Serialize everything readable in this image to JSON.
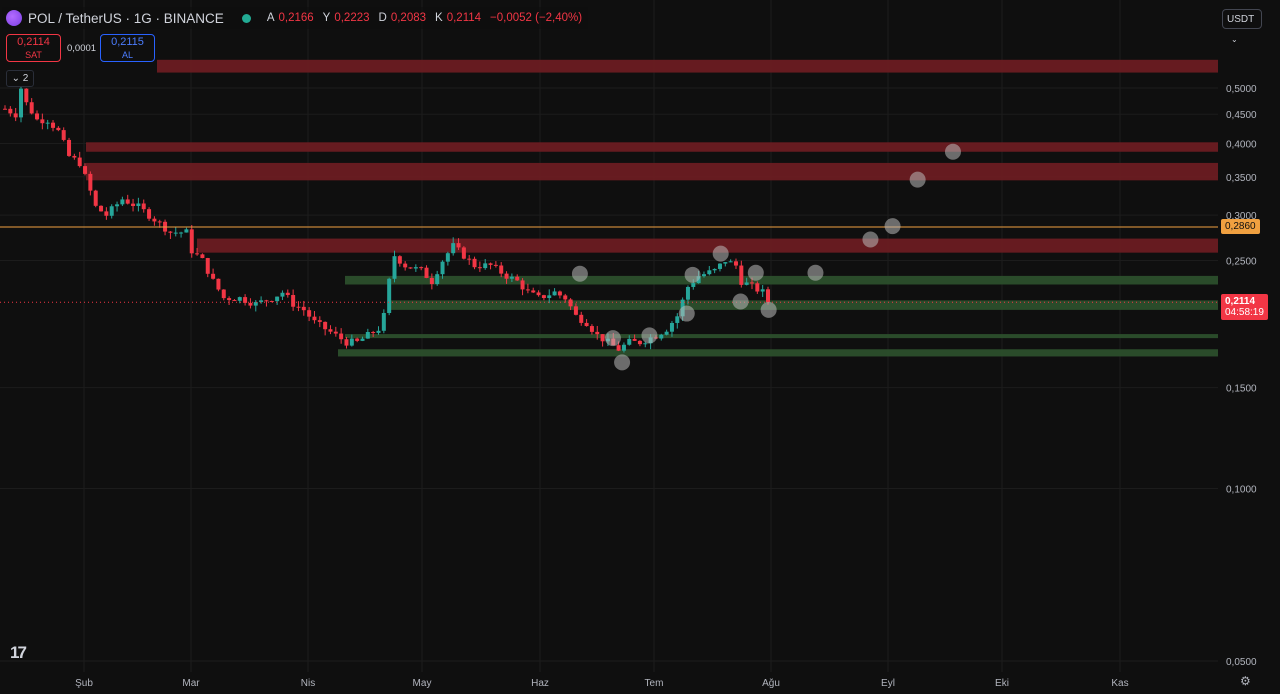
{
  "header": {
    "title": "POL / TetherUS · 1G · BINANCE",
    "ohlc": [
      {
        "label": "A",
        "value": "0,2166"
      },
      {
        "label": "Y",
        "value": "0,2223"
      },
      {
        "label": "D",
        "value": "0,2083"
      },
      {
        "label": "K",
        "value": "0,2114"
      }
    ],
    "change": "−0,0052 (−2,40%)"
  },
  "trade": {
    "sell_price": "0,2114",
    "sell_label": "SAT",
    "spread": "0,0001",
    "buy_price": "0,2115",
    "buy_label": "AL"
  },
  "indicator_toggle": "2",
  "currency_button": "USDT",
  "colors": {
    "background": "#0f0f0f",
    "up": "#26a69a",
    "down": "#f23645",
    "red_zone": "#6b1c22",
    "green_zone": "#2c4f2c",
    "orange_line": "#f0a040",
    "grid": "#1c1c1c"
  },
  "chart_data": {
    "type": "candlestick",
    "y_scale": "log",
    "ylim": [
      0.0478,
      0.55
    ],
    "ticks_y": [
      {
        "value": 0.5,
        "label": "0,5000"
      },
      {
        "value": 0.45,
        "label": "0,4500"
      },
      {
        "value": 0.4,
        "label": "0,4000"
      },
      {
        "value": 0.35,
        "label": "0,3500"
      },
      {
        "value": 0.3,
        "label": "0,3000"
      },
      {
        "value": 0.25,
        "label": "0,2500"
      },
      {
        "value": 0.15,
        "label": "0,1500"
      },
      {
        "value": 0.1,
        "label": "0,1000"
      },
      {
        "value": 0.05,
        "label": "0,0500"
      }
    ],
    "ticks_x": [
      {
        "label": "Şub",
        "month": 2
      },
      {
        "label": "Mar",
        "month": 3
      },
      {
        "label": "Nis",
        "month": 4
      },
      {
        "label": "May",
        "month": 5
      },
      {
        "label": "Haz",
        "month": 6
      },
      {
        "label": "Tem",
        "month": 7
      },
      {
        "label": "Ağu",
        "month": 8
      },
      {
        "label": "Eyl",
        "month": 9
      },
      {
        "label": "Eki",
        "month": 10
      },
      {
        "label": "Kas",
        "month": 11
      }
    ],
    "price_path": [
      [
        0,
        0.46
      ],
      [
        2,
        0.45
      ],
      [
        3,
        0.5
      ],
      [
        4,
        0.47
      ],
      [
        6,
        0.44
      ],
      [
        8,
        0.44
      ],
      [
        10,
        0.42
      ],
      [
        12,
        0.38
      ],
      [
        14,
        0.37
      ],
      [
        16,
        0.33
      ],
      [
        17,
        0.31
      ],
      [
        19,
        0.3
      ],
      [
        22,
        0.32
      ],
      [
        25,
        0.31
      ],
      [
        27,
        0.3
      ],
      [
        29,
        0.29
      ],
      [
        31,
        0.28
      ],
      [
        34,
        0.28
      ],
      [
        35,
        0.26
      ],
      [
        37,
        0.25
      ],
      [
        39,
        0.23
      ],
      [
        41,
        0.215
      ],
      [
        44,
        0.215
      ],
      [
        47,
        0.21
      ],
      [
        50,
        0.215
      ],
      [
        52,
        0.22
      ],
      [
        54,
        0.21
      ],
      [
        56,
        0.205
      ],
      [
        58,
        0.195
      ],
      [
        60,
        0.19
      ],
      [
        62,
        0.185
      ],
      [
        64,
        0.18
      ],
      [
        66,
        0.18
      ],
      [
        68,
        0.185
      ],
      [
        70,
        0.19
      ],
      [
        71,
        0.2
      ],
      [
        72,
        0.23
      ],
      [
        73,
        0.255
      ],
      [
        75,
        0.245
      ],
      [
        78,
        0.24
      ],
      [
        80,
        0.23
      ],
      [
        82,
        0.25
      ],
      [
        84,
        0.265
      ],
      [
        86,
        0.255
      ],
      [
        88,
        0.245
      ],
      [
        91,
        0.245
      ],
      [
        94,
        0.235
      ],
      [
        96,
        0.23
      ],
      [
        98,
        0.22
      ],
      [
        100,
        0.215
      ],
      [
        103,
        0.22
      ],
      [
        105,
        0.215
      ],
      [
        107,
        0.2
      ],
      [
        109,
        0.195
      ],
      [
        111,
        0.185
      ],
      [
        113,
        0.18
      ],
      [
        115,
        0.175
      ],
      [
        117,
        0.18
      ],
      [
        119,
        0.18
      ],
      [
        122,
        0.185
      ],
      [
        124,
        0.19
      ],
      [
        126,
        0.2
      ],
      [
        128,
        0.225
      ],
      [
        130,
        0.235
      ],
      [
        133,
        0.24
      ],
      [
        135,
        0.25
      ],
      [
        137,
        0.245
      ],
      [
        138,
        0.23
      ],
      [
        140,
        0.225
      ],
      [
        142,
        0.22
      ],
      [
        143,
        0.2114
      ]
    ],
    "candle_count": 144,
    "last_price": 0.2114,
    "last_price_label": "0,2114",
    "countdown": "04:58:19",
    "horizontal_line": {
      "value": 0.286,
      "label": "0,2860"
    },
    "zones": [
      {
        "type": "resistance",
        "low": 0.532,
        "high": 0.56
      },
      {
        "type": "resistance",
        "low": 0.387,
        "high": 0.402
      },
      {
        "type": "resistance",
        "low": 0.345,
        "high": 0.37
      },
      {
        "type": "resistance",
        "low": 0.258,
        "high": 0.273
      },
      {
        "type": "support",
        "low": 0.227,
        "high": 0.235
      },
      {
        "type": "support",
        "low": 0.205,
        "high": 0.213
      },
      {
        "type": "support",
        "low": 0.183,
        "high": 0.186
      },
      {
        "type": "support",
        "low": 0.17,
        "high": 0.175
      }
    ],
    "markers": [
      {
        "month": 6.35,
        "value": 0.237
      },
      {
        "month": 6.64,
        "value": 0.183
      },
      {
        "month": 6.72,
        "value": 0.166
      },
      {
        "month": 6.96,
        "value": 0.185
      },
      {
        "month": 7.28,
        "value": 0.202
      },
      {
        "month": 7.33,
        "value": 0.236
      },
      {
        "month": 7.57,
        "value": 0.257
      },
      {
        "month": 7.74,
        "value": 0.212
      },
      {
        "month": 7.87,
        "value": 0.238
      },
      {
        "month": 7.98,
        "value": 0.205
      },
      {
        "month": 8.38,
        "value": 0.238
      },
      {
        "month": 8.85,
        "value": 0.272
      },
      {
        "month": 9.04,
        "value": 0.287
      },
      {
        "month": 9.26,
        "value": 0.346
      },
      {
        "month": 9.57,
        "value": 0.387
      }
    ]
  }
}
